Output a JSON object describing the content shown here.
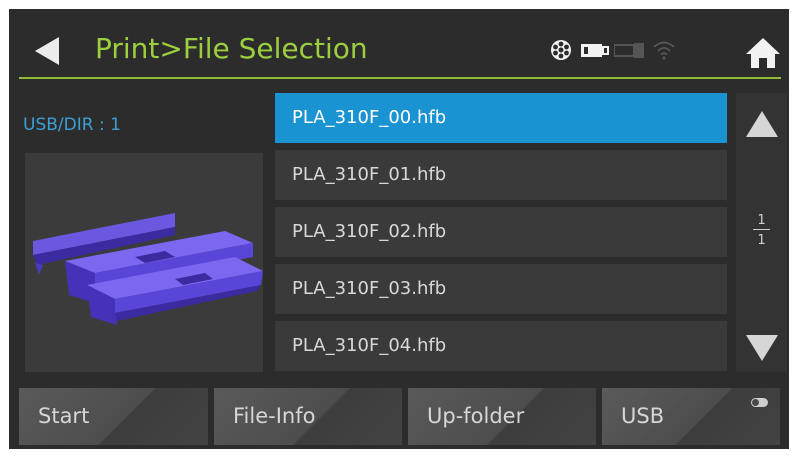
{
  "header": {
    "title": "Print>File Selection",
    "icons": [
      "filament-spool-icon",
      "usb-drive-icon",
      "sd-card-icon",
      "wifi-icon"
    ]
  },
  "left_panel": {
    "usb_dir": "USB/DIR : 1",
    "preview": "3d-model-preview"
  },
  "file_list": {
    "items": [
      {
        "label": "PLA_310F_00.hfb",
        "selected": true
      },
      {
        "label": "PLA_310F_01.hfb",
        "selected": false
      },
      {
        "label": "PLA_310F_02.hfb",
        "selected": false
      },
      {
        "label": "PLA_310F_03.hfb",
        "selected": false
      },
      {
        "label": "PLA_310F_04.hfb",
        "selected": false
      }
    ]
  },
  "pagination": {
    "current": "1",
    "total": "1"
  },
  "bottom_bar": {
    "start": "Start",
    "file_info": "File-Info",
    "up_folder": "Up-folder",
    "usb": "USB"
  },
  "colors": {
    "accent_green": "#9ccf3e",
    "selection_blue": "#1a93d2",
    "usb_dir_blue": "#3aa0d6",
    "background": "#2c2c2c"
  }
}
